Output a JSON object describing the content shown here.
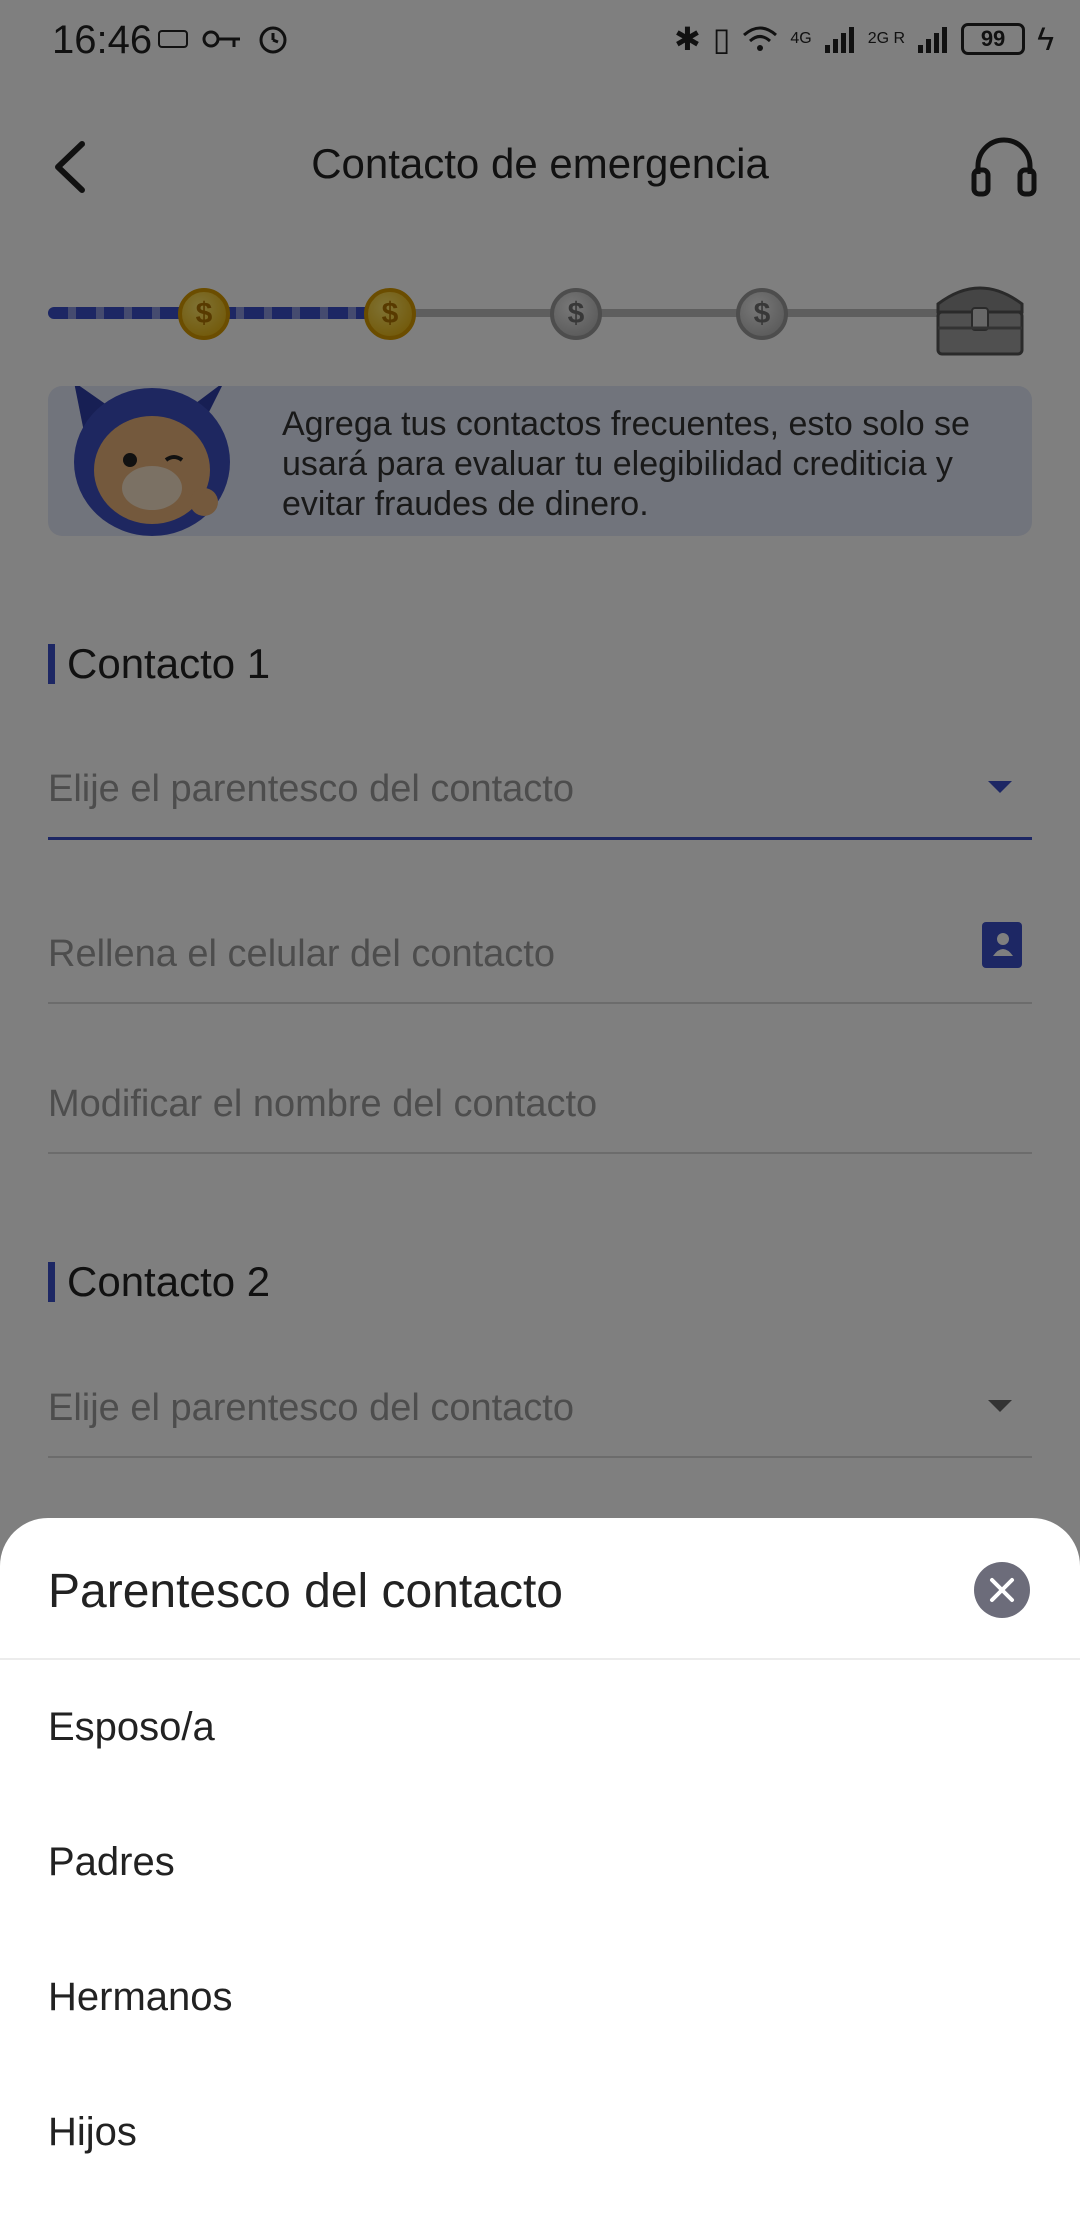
{
  "status_bar": {
    "time": "16:46",
    "battery": "99",
    "network_1": "4G",
    "network_2": "2G R"
  },
  "header": {
    "title": "Contacto de emergencia"
  },
  "banner": {
    "text": "Agrega tus contactos frecuentes, esto solo se usará para evaluar tu elegibilidad crediticia y evitar fraudes de dinero."
  },
  "progress": {
    "current_step": 2,
    "total_steps": 5,
    "coin_symbol": "$"
  },
  "contact1": {
    "title": "Contacto 1",
    "relationship_placeholder": "Elije el parentesco del contacto",
    "phone_placeholder": "Rellena el celular del contacto",
    "name_placeholder": "Modificar el nombre del contacto"
  },
  "contact2": {
    "title": "Contacto 2",
    "relationship_placeholder": "Elije el parentesco del contacto"
  },
  "sheet": {
    "title": "Parentesco del contacto",
    "options": [
      "Esposo/a",
      "Padres",
      "Hermanos",
      "Hijos"
    ]
  },
  "colors": {
    "accent": "#3b4fc8",
    "scrim": "rgba(0,0,0,0.5)",
    "coin_gold": "#e0a800",
    "coin_silver": "#a8a8a8"
  },
  "icons": [
    "back-arrow-icon",
    "headset-icon",
    "coin-icon",
    "treasure-chest-icon",
    "mascot-illustration",
    "dropdown-caret-icon",
    "contacts-book-icon",
    "close-icon"
  ]
}
